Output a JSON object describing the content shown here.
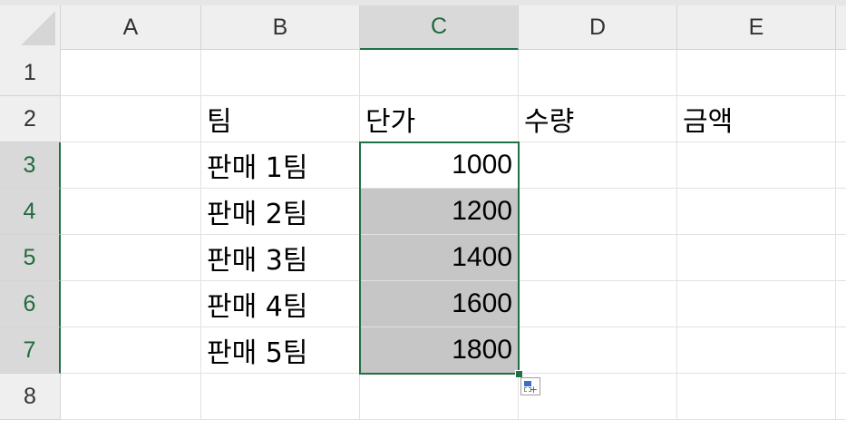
{
  "spreadsheet": {
    "columns": [
      "A",
      "B",
      "C",
      "D",
      "E"
    ],
    "rows": [
      "1",
      "2",
      "3",
      "4",
      "5",
      "6",
      "7",
      "8"
    ],
    "selected_column": "C",
    "selected_rows": [
      "3",
      "4",
      "5",
      "6",
      "7"
    ],
    "headers": {
      "B2": "팀",
      "C2": "단가",
      "D2": "수량",
      "E2": "금액"
    },
    "teams": [
      "판매 1팀",
      "판매 2팀",
      "판매 3팀",
      "판매 4팀",
      "판매 5팀"
    ],
    "unit_prices": [
      "1000",
      "1200",
      "1400",
      "1600",
      "1800"
    ]
  },
  "colors": {
    "accent": "#1e7145",
    "selection_shade": "#c6c6c6",
    "header_bg": "#efefef"
  },
  "icons": {
    "quick_analysis": "quick-analysis-icon",
    "select_all": "select-all-triangle-icon"
  }
}
